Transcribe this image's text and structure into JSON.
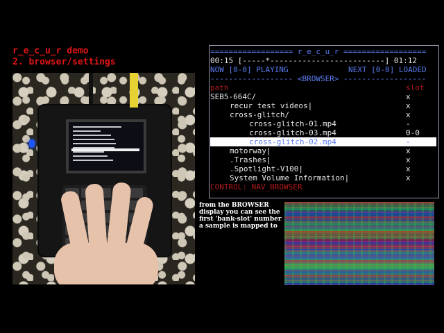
{
  "title": {
    "line1": "r_e_c_u_r demo",
    "line2": "2. browser/settings"
  },
  "photo": {
    "device_screen_lines": 9
  },
  "terminal": {
    "header": "================== r_e_c_u_r ==================",
    "time_left": "00:15",
    "progress": "[-----*-------------------------]",
    "time_right": "01:12",
    "now_label": "NOW [0-0] PLAYING",
    "next_label": "NEXT [0-0] LOADED",
    "browser_bar": "------------------ <BROWSER> ------------------",
    "col_path": "path",
    "col_slot": "slot",
    "rows": [
      {
        "name": "SEB5-664C/",
        "slot": "x",
        "indent": 0,
        "selected": false
      },
      {
        "name": "recur test videos|",
        "slot": "x",
        "indent": 4,
        "selected": false
      },
      {
        "name": "cross-glitch/",
        "slot": "x",
        "indent": 4,
        "selected": false
      },
      {
        "name": "cross-glitch-01.mp4",
        "slot": "-",
        "indent": 8,
        "selected": false
      },
      {
        "name": "cross-glitch-03.mp4",
        "slot": "0-0",
        "indent": 8,
        "selected": false
      },
      {
        "name": "cross-glitch-02.mp4",
        "slot": "-",
        "indent": 8,
        "selected": true
      },
      {
        "name": "motorway|",
        "slot": "x",
        "indent": 4,
        "selected": false
      },
      {
        "name": ".Trashes|",
        "slot": "x",
        "indent": 4,
        "selected": false
      },
      {
        "name": ".Spotlight-V100|",
        "slot": "x",
        "indent": 4,
        "selected": false
      },
      {
        "name": "System Volume Information|",
        "slot": "x",
        "indent": 4,
        "selected": false
      }
    ],
    "control": "CONTROL: NAV_BROWSER"
  },
  "caption": "from the BROWSER display you can see the first 'bank-slot' number a sample is mapped to",
  "colors": {
    "title_red": "#e01515",
    "term_blue": "#5b7cf0",
    "term_red": "#b21a1a",
    "device_strap": "#e6d232"
  }
}
